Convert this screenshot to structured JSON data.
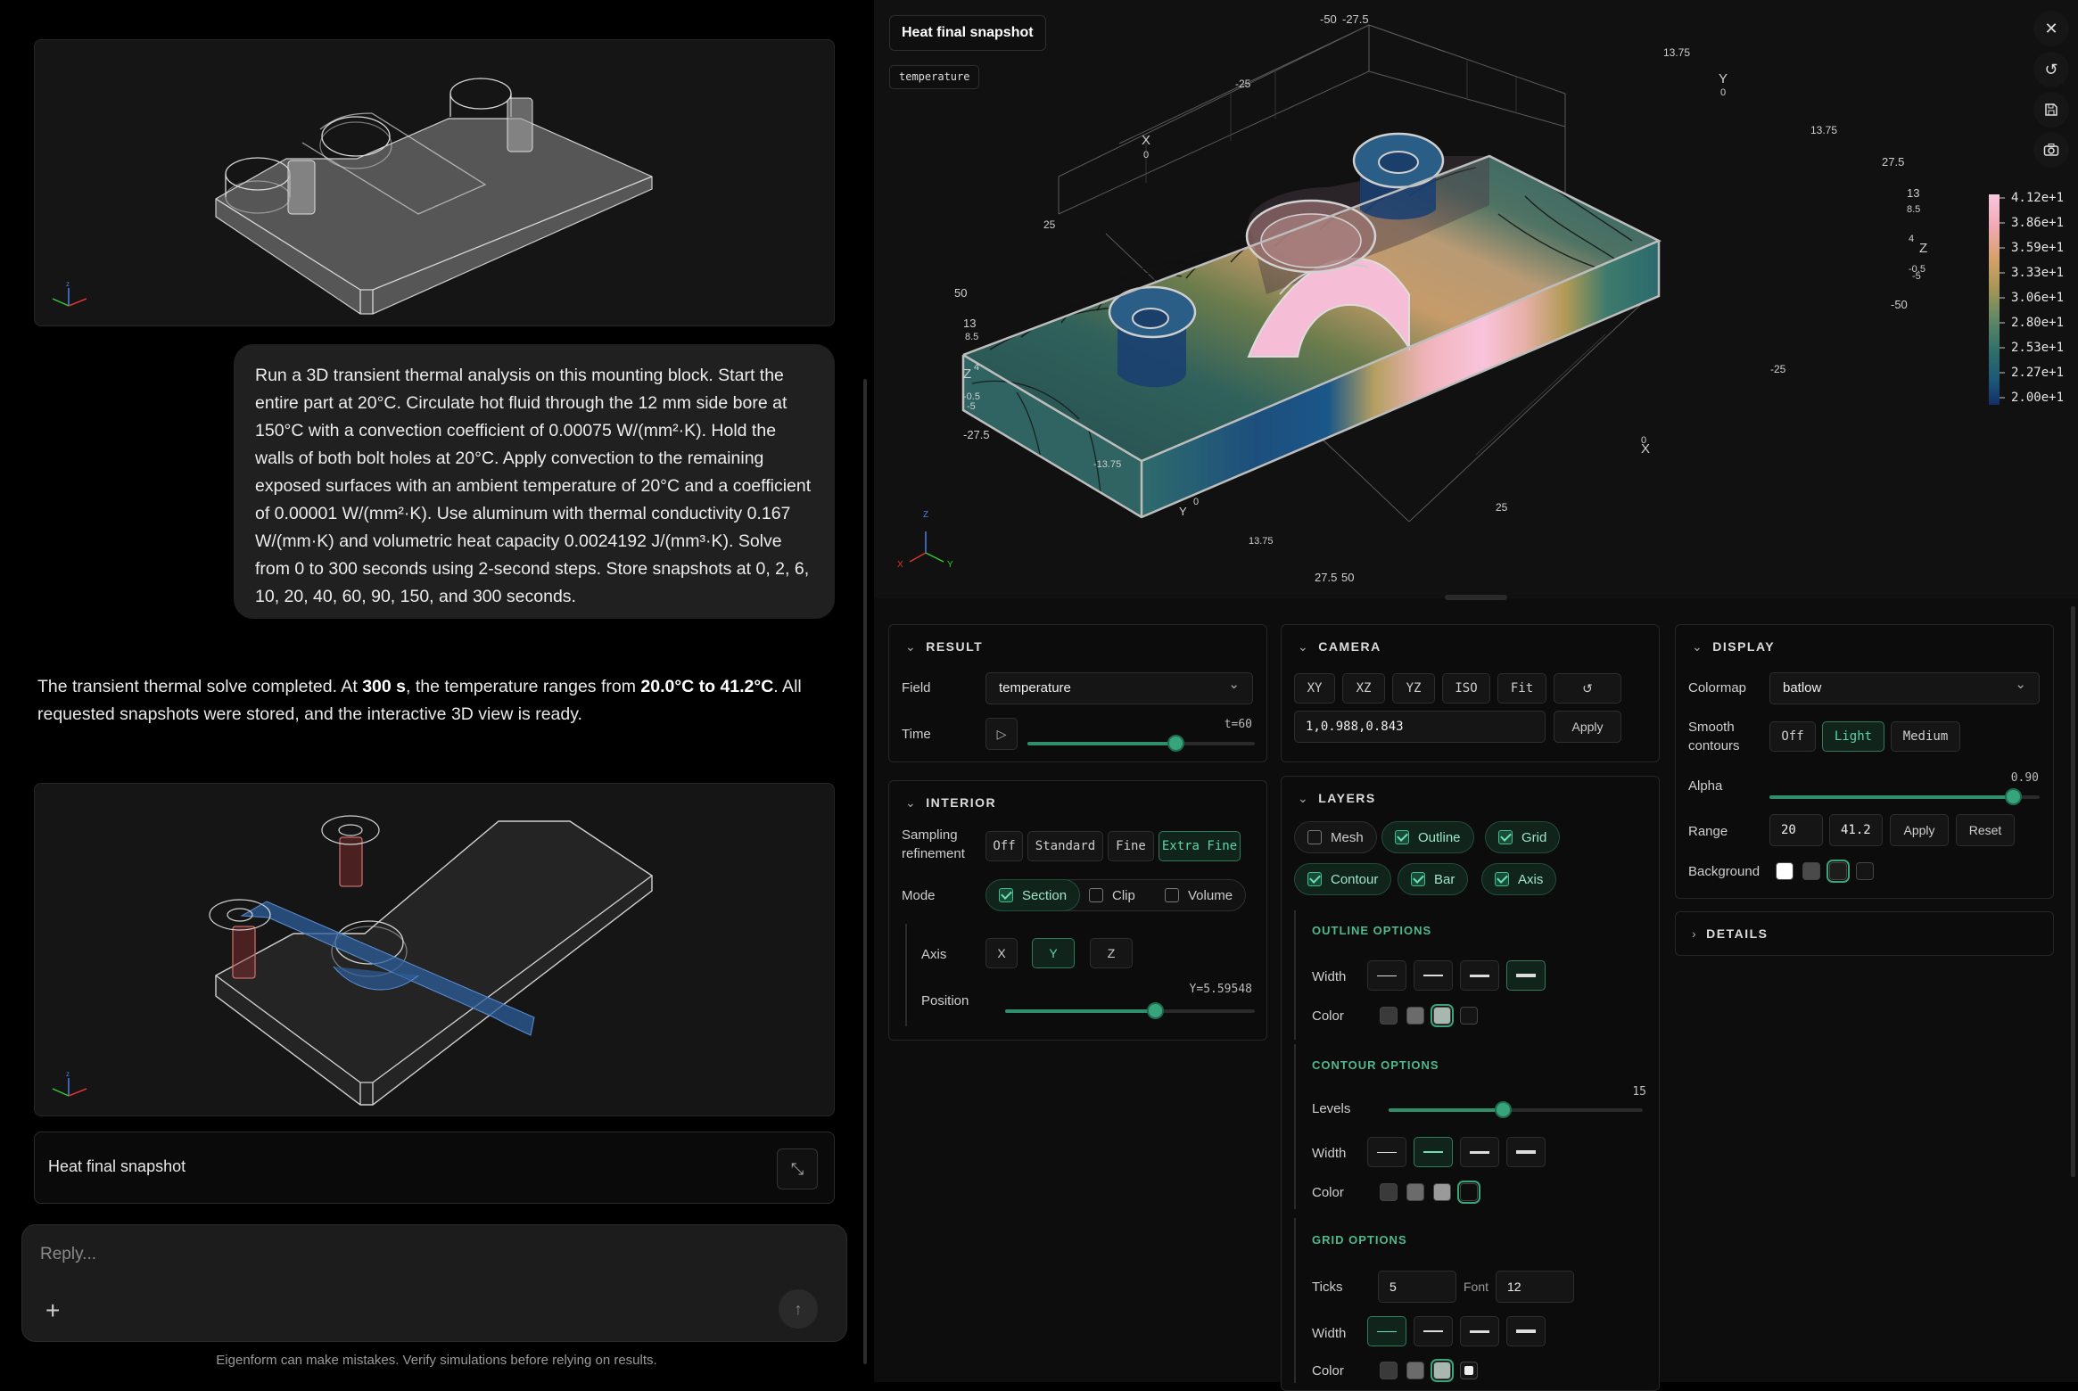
{
  "chat": {
    "user_message": "Run a 3D transient thermal analysis on this mounting block. Start the entire part at 20°C. Circulate hot fluid through the 12 mm side bore at 150°C with a convection coefficient of 0.00075 W/(mm²·K). Hold the walls of both bolt holes at 20°C. Apply convection to the remaining exposed surfaces with an ambient temperature of 20°C and a coefficient of 0.00001 W/(mm²·K). Use aluminum with thermal conductivity 0.167 W/(mm·K) and volumetric heat capacity 0.0024192 J/(mm³·K). Solve from 0 to 300 seconds using 2-second steps. Store snapshots at 0, 2, 6, 10, 20, 40, 60, 90, 150, and 300 seconds.",
    "response_a": "The transient thermal solve completed. At ",
    "response_b1": "300 s",
    "response_c": ", the temperature ranges from ",
    "response_b2": "20.0°C to 41.2°C",
    "response_d": ". All requested snapshots were stored, and the interactive 3D view is ready.",
    "snapshot_card_title": "Heat final snapshot",
    "reply_placeholder": "Reply...",
    "disclaimer": "Eigenform can make mistakes. Verify simulations before relying on results.",
    "triad_labels": {
      "x": "X",
      "y": "Y",
      "z": "Z"
    }
  },
  "viewer": {
    "title": "Heat final snapshot",
    "field_tag": "temperature",
    "colorbar_labels": [
      "4.12e+1",
      "3.86e+1",
      "3.59e+1",
      "3.33e+1",
      "3.06e+1",
      "2.80e+1",
      "2.53e+1",
      "2.27e+1",
      "2.00e+1"
    ],
    "colormap_colors": [
      "#f8c7e0",
      "#f1a9b5",
      "#d7a26d",
      "#a59657",
      "#5e8766",
      "#2f6e6a",
      "#1e5876",
      "#173e72",
      "#142f66"
    ],
    "axis_labels": {
      "x_top": "X",
      "x_top_0": "0",
      "x_bottom": "X",
      "x_bottom_0": "0",
      "y_top": "Y",
      "y_top_0": "0",
      "y_bottom": "Y",
      "y_bottom_0": "0",
      "z_left": "Z",
      "z_right": "Z",
      "t1": "-50",
      "t2": "-27.5",
      "t3": "13.75",
      "t4": "-25",
      "t5": "13.75",
      "t6": "27.5",
      "t7": "25",
      "t8": "50",
      "t9": "13",
      "t10": "8.5",
      "t11": "4",
      "t12": "-0.5",
      "t13": "-5",
      "t14": "-27.5",
      "t15": "-13.75",
      "t16": "13.75",
      "t17": "27.5",
      "t18": "25",
      "t19": "50",
      "t20": "-25",
      "t21": "-50",
      "t22": "13",
      "t23": "8.5",
      "t24": "4",
      "t25": "-0.5",
      "t26": "-5"
    }
  },
  "result": {
    "header": "RESULT",
    "field_label": "Field",
    "field_value": "temperature",
    "time_label": "Time",
    "time_value": "t=60",
    "time_fraction": 0.65
  },
  "interior": {
    "header": "INTERIOR",
    "sampling_label": "Sampling refinement",
    "sampling_options": [
      "Off",
      "Standard",
      "Fine",
      "Extra Fine"
    ],
    "sampling_selected": "Extra Fine",
    "mode_label": "Mode",
    "modes": [
      "Section",
      "Clip",
      "Volume"
    ],
    "mode_selected": "Section",
    "axis_label": "Axis",
    "axes": [
      "X",
      "Y",
      "Z"
    ],
    "axis_selected": "Y",
    "position_label": "Position",
    "position_value": "Y=5.59548",
    "position_fraction": 0.6
  },
  "camera": {
    "header": "CAMERA",
    "views": [
      "XY",
      "XZ",
      "YZ",
      "ISO",
      "Fit"
    ],
    "direction": "1,0.988,0.843",
    "apply": "Apply"
  },
  "layers": {
    "header": "LAYERS",
    "chips": [
      {
        "label": "Mesh",
        "on": false
      },
      {
        "label": "Outline",
        "on": true
      },
      {
        "label": "Grid",
        "on": true
      },
      {
        "label": "Contour",
        "on": true
      },
      {
        "label": "Bar",
        "on": true
      },
      {
        "label": "Axis",
        "on": true
      }
    ],
    "outline_header": "OUTLINE OPTIONS",
    "width_label": "Width",
    "color_label": "Color",
    "contour_header": "CONTOUR OPTIONS",
    "levels_label": "Levels",
    "levels_value": "15",
    "levels_fraction": 0.45,
    "grid_header": "GRID OPTIONS",
    "ticks_label": "Ticks",
    "ticks_value": "5",
    "font_label": "Font",
    "font_value": "12"
  },
  "display": {
    "header": "DISPLAY",
    "colormap_label": "Colormap",
    "colormap_value": "batlow",
    "smooth_label": "Smooth contours",
    "smooth_options": [
      "Off",
      "Light",
      "Medium"
    ],
    "smooth_selected": "Light",
    "alpha_label": "Alpha",
    "alpha_value": "0.90",
    "alpha_fraction": 0.9,
    "range_label": "Range",
    "range_min": "20",
    "range_max": "41.2",
    "apply": "Apply",
    "reset": "Reset",
    "background_label": "Background",
    "details_header": "DETAILS"
  }
}
